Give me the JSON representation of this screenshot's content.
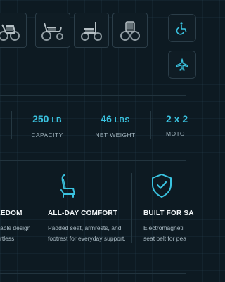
{
  "gallery": {
    "thumbnails": [
      {
        "name": "wheelchair-front-view"
      },
      {
        "name": "wheelchair-side-view"
      },
      {
        "name": "wheelchair-folded-view"
      },
      {
        "name": "wheelchair-rear-view"
      }
    ]
  },
  "side_actions": {
    "items": [
      {
        "icon": "wheelchair-icon"
      },
      {
        "icon": "airplane-icon"
      }
    ]
  },
  "specs": {
    "items": [
      {
        "value": "250",
        "unit": "LB",
        "label": "CAPACITY"
      },
      {
        "value": "46",
        "unit": "LBS",
        "label": "NET WEIGHT"
      },
      {
        "value": "2 x 2",
        "unit": "",
        "label": "MOTO"
      }
    ]
  },
  "features": {
    "items": [
      {
        "icon": "feather-icon",
        "title": "EEDOM",
        "desc": [
          "able design",
          "rtless."
        ]
      },
      {
        "icon": "seat-icon",
        "title": "ALL-DAY COMFORT",
        "desc": [
          "Padded seat, armrests, and",
          "footrest for everyday support."
        ]
      },
      {
        "icon": "shield-check-icon",
        "title": "BUILT FOR SA",
        "desc": [
          "Electromagneti",
          "seat belt for pea"
        ]
      }
    ]
  },
  "colors": {
    "accent": "#3ac3e0",
    "background": "#0d1a22",
    "border": "#2b3d48"
  }
}
